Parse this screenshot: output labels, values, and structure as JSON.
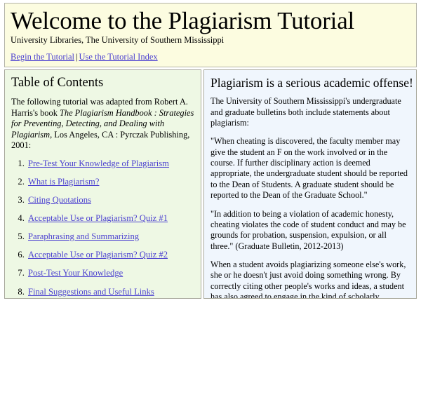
{
  "header": {
    "title": "Welcome to the Plagiarism Tutorial",
    "subtitle": "University Libraries, The University of Southern Mississippi",
    "links": [
      {
        "label": "Begin the Tutorial"
      },
      {
        "label": "Use the Tutorial Index"
      }
    ],
    "link_separator": "|",
    "background_color": "#fcfce0"
  },
  "toc_panel": {
    "heading": "Table of Contents",
    "background_color": "#eef8e4",
    "intro_before": "The following tutorial was adapted from Robert A. Harris's book ",
    "intro_book_title": "The Plagiarism Handbook : Strategies for Preventing, Detecting, and Dealing with Plagiarism",
    "intro_after": ", Los Angeles, CA : Pyrczak Publishing, 2001:",
    "items": [
      {
        "number": "1.",
        "label": "Pre-Test Your Knowledge of Plagiarism"
      },
      {
        "number": "2.",
        "label": "What is Plagiarism?"
      },
      {
        "number": "3.",
        "label": "Citing Quotations"
      },
      {
        "number": "4.",
        "label": "Acceptable Use or Plagiarism? Quiz #1"
      },
      {
        "number": "5.",
        "label": "Paraphrasing and Summarizing"
      },
      {
        "number": "6.",
        "label": "Acceptable Use or Plagiarism? Quiz #2"
      },
      {
        "number": "7.",
        "label": "Post-Test Your Knowledge"
      },
      {
        "number": "8.",
        "label": "Final Suggestions and Useful Links"
      }
    ]
  },
  "offense_panel": {
    "heading": "Plagiarism is a serious academic offense!",
    "background_color": "#f0f6fd",
    "paragraphs": [
      "The University of Southern Mississippi's undergraduate and graduate bulletins both include statements about plagiarism:",
      "\"When cheating is discovered, the faculty member may give the student an F on the work involved or in the course. If further disciplinary action is deemed appropriate, the undergraduate student should be reported to the Dean of Students. A graduate student should be reported to the Dean of the Graduate School.\"",
      "\"In addition to being a violation of academic honesty, cheating violates the code of student conduct and may be grounds for probation, suspension, expulsion, or all three.\" (Graduate Bulletin, 2012-2013)",
      "When a student avoids plagiarizing someone else's work, she or he doesn't just avoid doing something wrong. By correctly citing other people's works and ideas, a student has also agreed to engage in the kind of scholarly communication that is part of academic life. Citing another person's words is a way of giving credit to that person, and of acknowledging the importance of that person's work to one's own ideas. After all, you wouldn't want someone quoting your words or using your ideas without giving you credit, would you?"
    ]
  },
  "theme": {
    "link_color": "#4a3fd0",
    "border_color": "#a8a89c",
    "page_background": "#ffffff"
  }
}
